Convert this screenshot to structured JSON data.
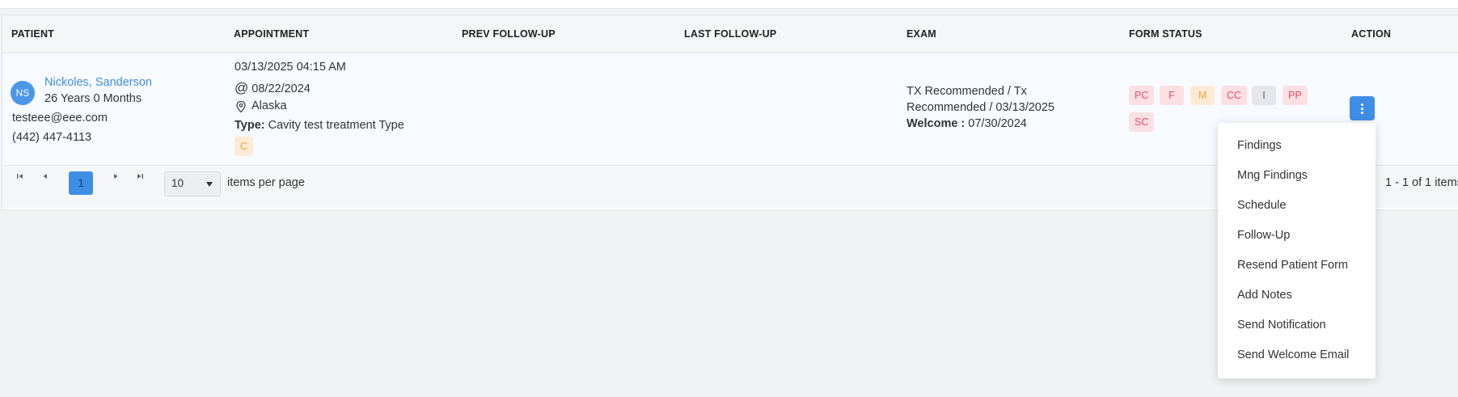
{
  "table": {
    "headers": [
      "PATIENT",
      "APPOINTMENT",
      "PREV FOLLOW-UP",
      "LAST FOLLOW-UP",
      "EXAM",
      "FORM STATUS",
      "ACTION"
    ],
    "row": {
      "patient": {
        "initials": "NS",
        "name": "Nickoles, Sanderson",
        "age": "26 Years 0 Months",
        "email": "testeee@eee.com",
        "phone": "(442) 447-4113"
      },
      "appointment": {
        "datetime": "03/13/2025 04:15 AM",
        "at_prefix": "@",
        "at_date": "08/22/2024",
        "location": "Alaska",
        "type_label": "Type:",
        "type_value": "Cavity test treatment Type",
        "chip": "C"
      },
      "prev_followup": "",
      "last_followup": "",
      "exam": {
        "line1": "TX Recommended / Tx",
        "line2": "Recommended / 03/13/2025",
        "welcome_label": "Welcome :",
        "welcome_date": "07/30/2024"
      },
      "form_status": [
        {
          "label": "PC",
          "color": "#e24f62"
        },
        {
          "label": "F",
          "color": "#e24f62"
        },
        {
          "label": "M",
          "color": "#f2a43a"
        },
        {
          "label": "CC",
          "color": "#e24f62"
        },
        {
          "label": "I",
          "color": "#666666"
        },
        {
          "label": "PP",
          "color": "#e24f62"
        },
        {
          "label": "SC",
          "color": "#e24f62"
        }
      ],
      "action_icon": "vertical-dots-icon"
    }
  },
  "pagination": {
    "current_page": "1",
    "page_size": "10",
    "items_per_page_label": "items per page",
    "summary": "1 - 1 of 1 items",
    "icons": [
      "first-page-icon",
      "prev-page-icon",
      "next-page-icon",
      "last-page-icon"
    ]
  },
  "action_menu": {
    "items": [
      "Findings",
      "Mng Findings",
      "Schedule",
      "Follow-Up",
      "Resend Patient Form",
      "Add Notes",
      "Send Notification",
      "Send Welcome Email"
    ]
  },
  "colors": {
    "accent": "#3f8ee5",
    "status_pink_bg": "#fde0e3",
    "status_orange_bg": "#fdebd8",
    "status_gray_bg": "#e4e6e9"
  }
}
